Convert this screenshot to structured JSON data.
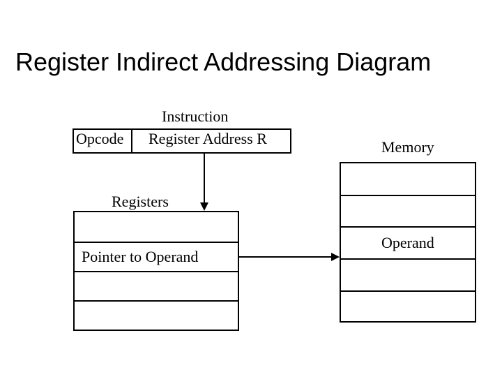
{
  "title": "Register Indirect Addressing Diagram",
  "instruction_label": "Instruction",
  "fields": {
    "opcode": "Opcode",
    "register_address": "Register Address R"
  },
  "memory_label": "Memory",
  "registers_label": "Registers",
  "register_rows": [
    "",
    "Pointer to Operand",
    "",
    ""
  ],
  "memory_rows": [
    "",
    "",
    "Operand",
    "",
    ""
  ],
  "arrows": [
    {
      "from": "register_address",
      "to": "registers_table"
    },
    {
      "from": "pointer_to_operand",
      "to": "memory_operand"
    }
  ]
}
